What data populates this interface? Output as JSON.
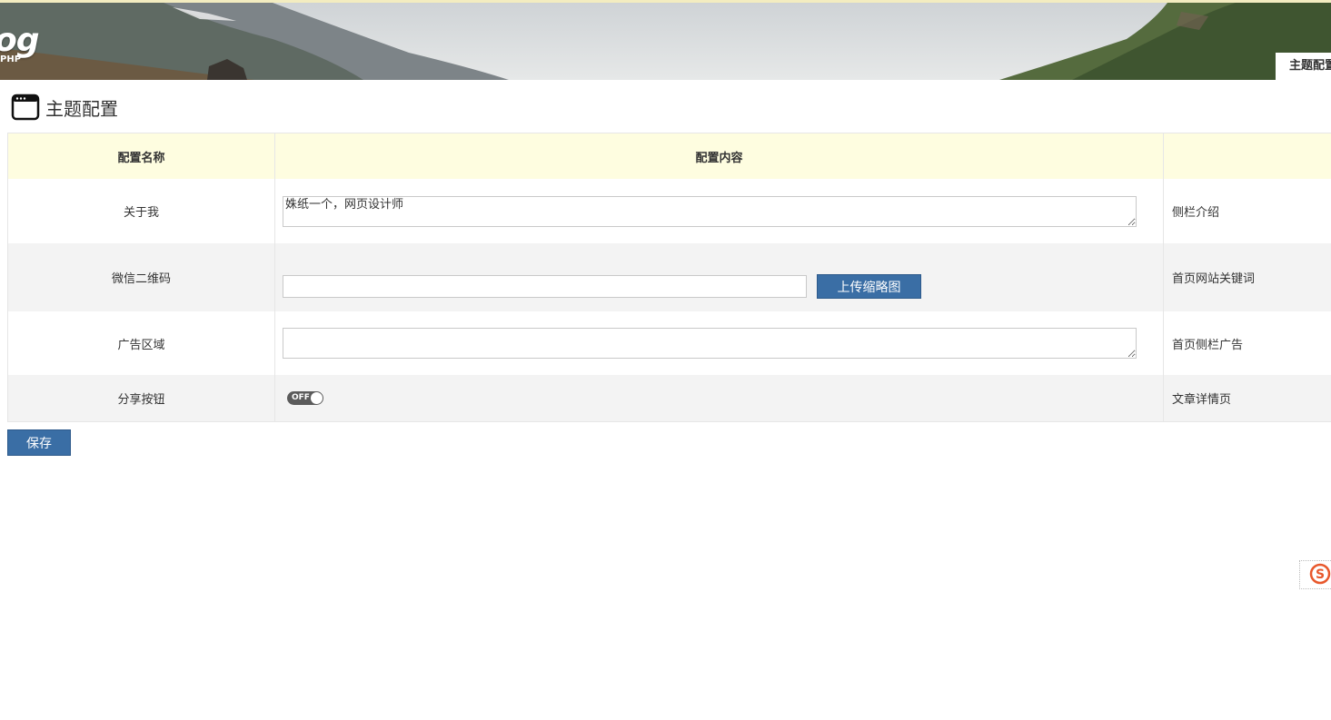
{
  "header": {
    "logo_text": "og",
    "logo_sub": "PHP",
    "tab_label": "主题配置"
  },
  "page": {
    "title": "主题配置",
    "title_icon": "window-icon"
  },
  "table": {
    "headers": [
      "配置名称",
      "配置内容",
      ""
    ],
    "rows": [
      {
        "name": "关于我",
        "value": "姝纸一个，网页设计师",
        "desc": "侧栏介绍"
      },
      {
        "name": "微信二维码",
        "value": "",
        "upload_label": "上传缩略图",
        "desc": "首页网站关键词"
      },
      {
        "name": "广告区域",
        "value": "",
        "desc": "首页侧栏广告"
      },
      {
        "name": "分享按钮",
        "toggle_label": "OFF",
        "toggle_on": false,
        "desc": "文章详情页"
      }
    ]
  },
  "actions": {
    "save_label": "保存"
  },
  "widget": {
    "icon": "sogou-s-icon",
    "glyph": "S"
  },
  "colors": {
    "primary": "#3a6ea5",
    "header_row": "#fefde0",
    "stripe": "#f3f3f3",
    "widget": "#e8582c"
  }
}
